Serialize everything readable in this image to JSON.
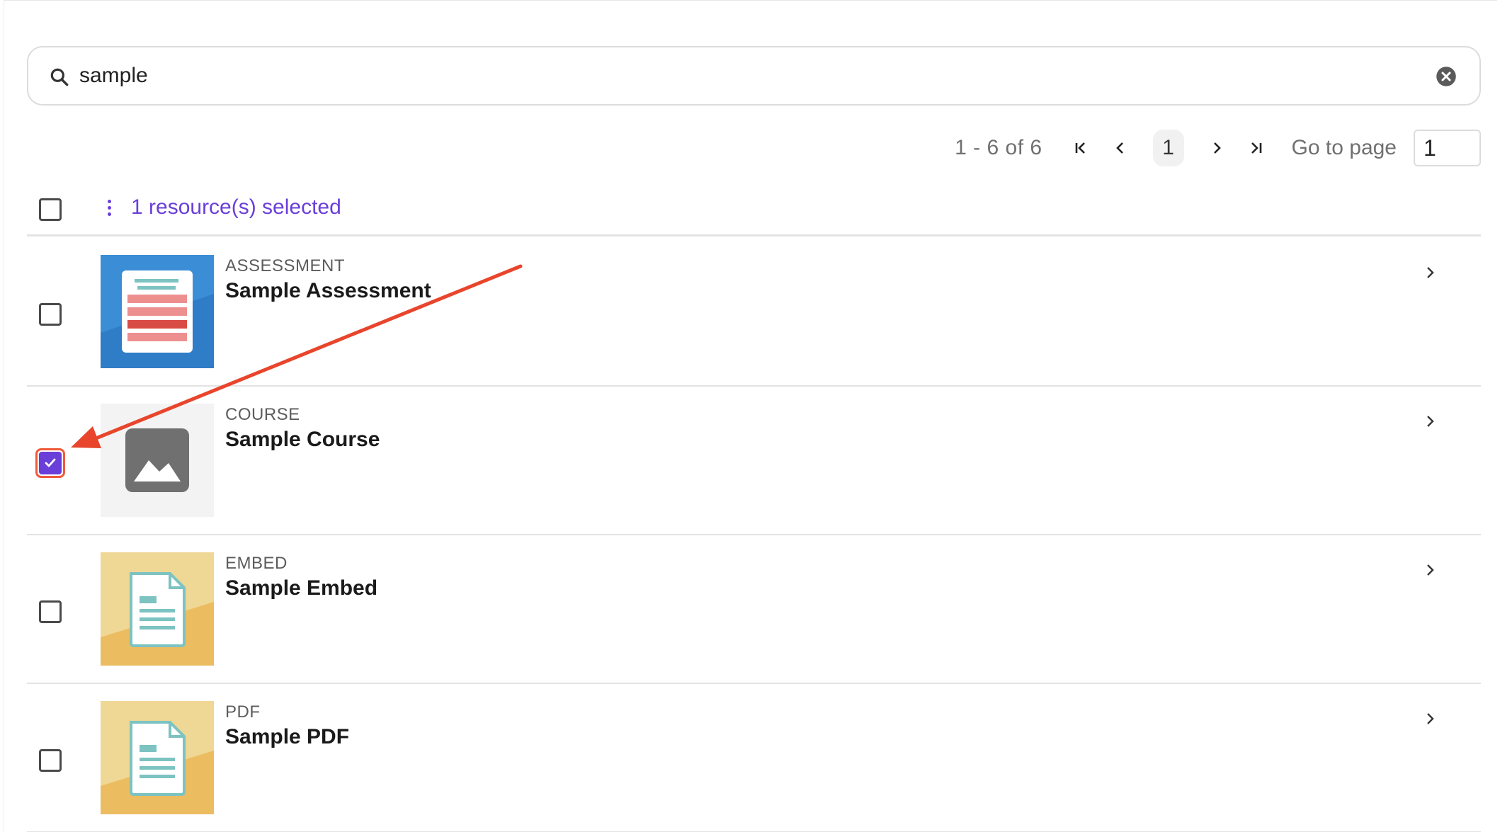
{
  "search": {
    "value": "sample",
    "icon": "search-icon",
    "clear_icon": "clear-icon"
  },
  "pagination": {
    "range": "1 - 6 of 6",
    "current_page": "1",
    "goto_label": "Go to page",
    "goto_value": "1"
  },
  "selection": {
    "label": "1 resource(s) selected",
    "accent": "#6a3fd9"
  },
  "resources": [
    {
      "type": "ASSESSMENT",
      "title": "Sample Assessment",
      "checked": false,
      "thumbnail": "assessment-thumbnail"
    },
    {
      "type": "COURSE",
      "title": "Sample Course",
      "checked": true,
      "thumbnail": "image-placeholder-thumbnail"
    },
    {
      "type": "EMBED",
      "title": "Sample Embed",
      "checked": false,
      "thumbnail": "document-thumbnail"
    },
    {
      "type": "PDF",
      "title": "Sample PDF",
      "checked": false,
      "thumbnail": "document-thumbnail"
    }
  ],
  "colors": {
    "annotation_arrow": "#e8452c",
    "assessment_blue": "#3b8ed6",
    "doc_yellow": "#edc56f"
  }
}
